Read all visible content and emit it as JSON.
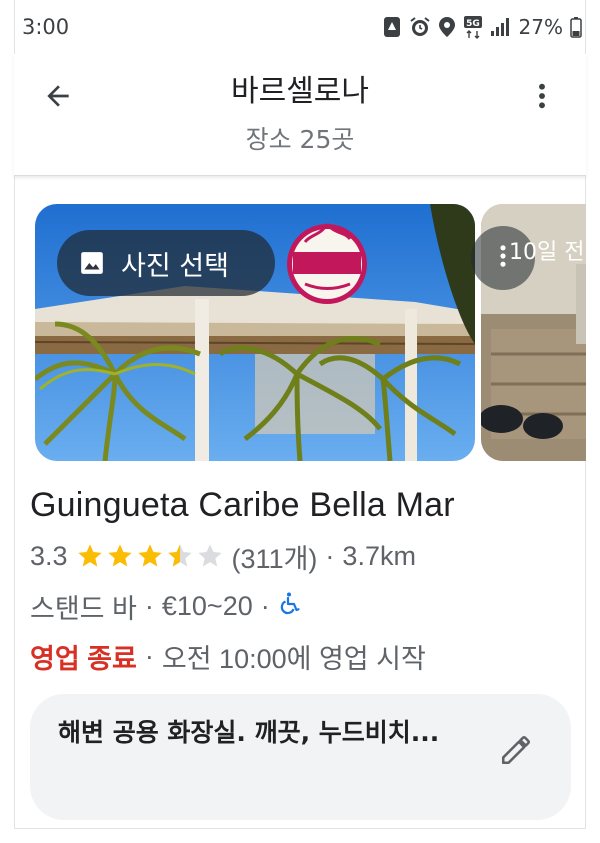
{
  "status_bar": {
    "time": "3:00",
    "network": "5G",
    "battery": "27%",
    "icons": [
      "notification-app-icon",
      "alarm-icon",
      "location-icon",
      "network-5g-icon",
      "signal-icon",
      "battery-icon"
    ]
  },
  "header": {
    "title": "바르셀로나",
    "subtitle": "장소 25곳",
    "back_icon": "arrow-left-icon",
    "menu_icon": "more-vert-icon"
  },
  "carousel": {
    "select_photo_label": "사진 선택",
    "select_photo_icon": "image-icon",
    "next_photo_date": "10일 전",
    "next_photo_menu_icon": "more-vert-icon"
  },
  "place": {
    "name": "Guingueta Caribe Bella Mar",
    "rating": "3.3",
    "stars": 3.3,
    "stars_max": 5,
    "review_count": "(311개)",
    "distance": "3.7km",
    "category": "스탠드 바",
    "price": "€10~20",
    "accessibility_icon": "wheelchair-accessible-icon",
    "hours_status": "영업 종료",
    "hours_detail": "오전 10:00에 영업 시작"
  },
  "note": {
    "text": "해변 공용 화장실. 깨끗, 누드비치...",
    "edit_icon": "pencil-icon"
  },
  "colors": {
    "star": "#fbbc04",
    "star_empty": "#dadce0",
    "closed": "#d93025",
    "accessible": "#1a73e8",
    "note_bg": "#f1f3f4"
  }
}
